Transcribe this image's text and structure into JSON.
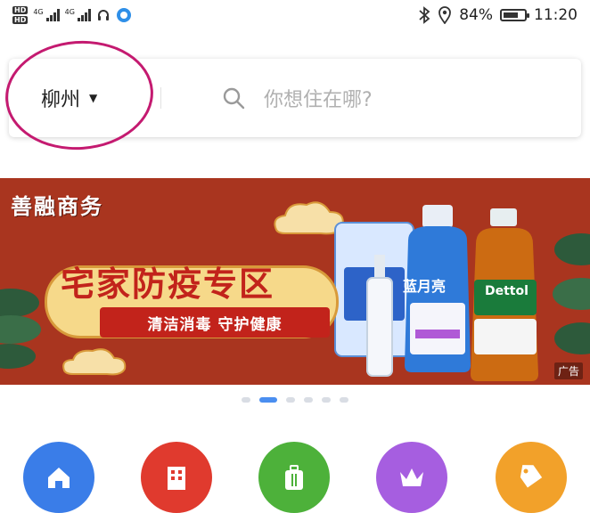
{
  "status_bar": {
    "hd1": "HD",
    "hd2": "HD",
    "network1": "4G",
    "network2": "4G",
    "battery_percent": "84%",
    "time": "11:20"
  },
  "search": {
    "city": "柳州",
    "placeholder": "你想住在哪?"
  },
  "banner": {
    "brand": "善融商务",
    "title": "宅家防疫专区",
    "subtitle": "清洁消毒 守护健康",
    "ad_tag": "广告",
    "product_label_1": "蓝月亮",
    "product_label_2": "Dettol"
  },
  "carousel": {
    "count": 6,
    "active_index": 1
  },
  "categories": [
    {
      "icon": "home-icon",
      "color": "#3a7de8"
    },
    {
      "icon": "building-icon",
      "color": "#e03a2e"
    },
    {
      "icon": "luggage-icon",
      "color": "#4db13a"
    },
    {
      "icon": "crown-icon",
      "color": "#a65ee0"
    },
    {
      "icon": "tag-icon",
      "color": "#f2a12a"
    }
  ]
}
